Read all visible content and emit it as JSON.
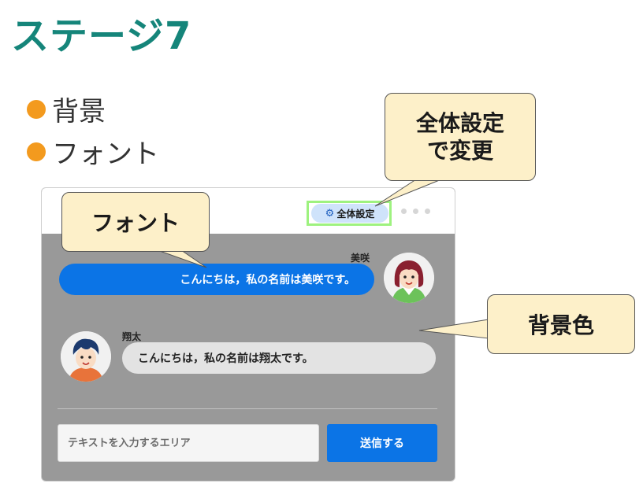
{
  "slide": {
    "title": "ステージ7",
    "bullets": [
      "背景",
      "フォント"
    ]
  },
  "app": {
    "settings_button": "全体設定",
    "messages": [
      {
        "sender": "美咲",
        "text": "こんにちは，私の名前は美咲です。",
        "side": "right"
      },
      {
        "sender": "翔太",
        "text": "こんにちは，私の名前は翔太です。",
        "side": "left"
      }
    ],
    "input_placeholder": "テキストを入力するエリア",
    "send_button": "送信する"
  },
  "callouts": {
    "settings": "全体設定\nで変更",
    "font": "フォント",
    "background": "背景色"
  },
  "colors": {
    "title": "#15857a",
    "bullet_dot": "#f39a1e",
    "chat_background": "#999999",
    "user_bubble": "#0b74e6",
    "partner_bubble": "#e3e3e3",
    "send_button": "#0b74e6",
    "callout_fill": "#fdf0c9",
    "highlight_frame": "#9ef27f"
  },
  "icons": {
    "settings": "gear-icon",
    "menu": "more-dots-icon"
  }
}
